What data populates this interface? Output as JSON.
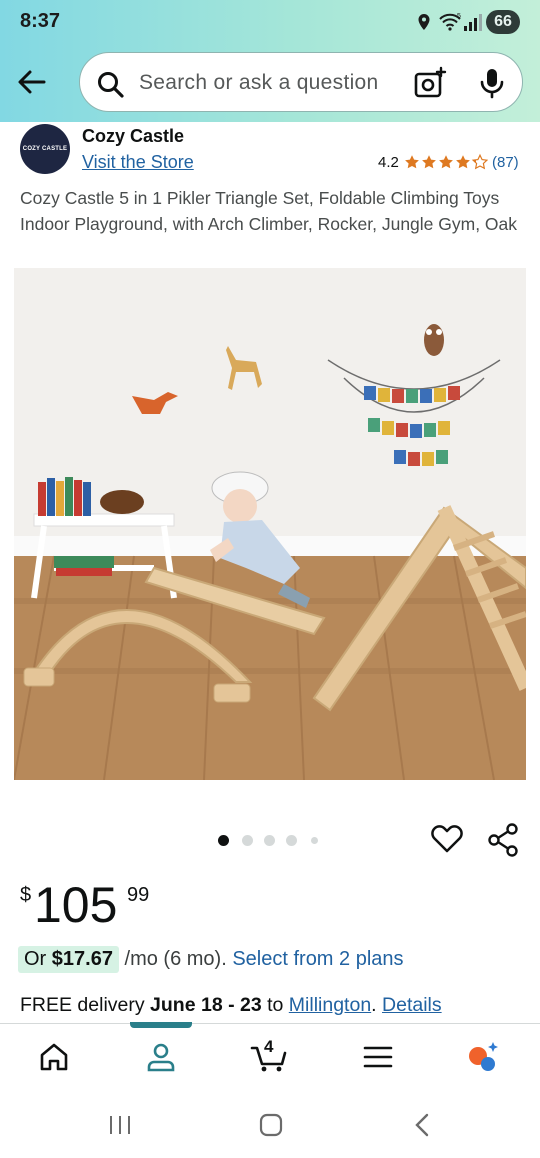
{
  "status_bar": {
    "time": "8:37",
    "battery": "66"
  },
  "search": {
    "placeholder": "Search or ask a question"
  },
  "store": {
    "logo_text": "COZY CASTLE",
    "name": "Cozy Castle",
    "visit_label": "Visit the Store"
  },
  "rating": {
    "value": "4.2",
    "count": "(87)",
    "stars": 4.2
  },
  "product": {
    "title": "Cozy Castle 5 in 1 Pikler Triangle Set, Foldable Climbing Toys Indoor Playground, with Arch Climber, Rocker, Jungle Gym, Oak"
  },
  "gallery": {
    "total": 5,
    "active_index": 0
  },
  "price": {
    "currency": "$",
    "whole": "105",
    "cents": "99"
  },
  "installment": {
    "prefix": "Or",
    "amount": "$17.67",
    "suffix": "/mo (6 mo).",
    "link": "Select from 2 plans"
  },
  "delivery": {
    "prefix": "FREE delivery",
    "dates": "June 18 - 23",
    "to": "to",
    "location": "Millington",
    "details": "Details"
  },
  "bottom_nav": {
    "cart_count": "4",
    "active": "account"
  },
  "colors": {
    "header_start": "#82d8e3",
    "header_end": "#c3efd9",
    "link": "#2162a1",
    "star": "#de7921",
    "nav_indicator": "#2a7f8a"
  }
}
